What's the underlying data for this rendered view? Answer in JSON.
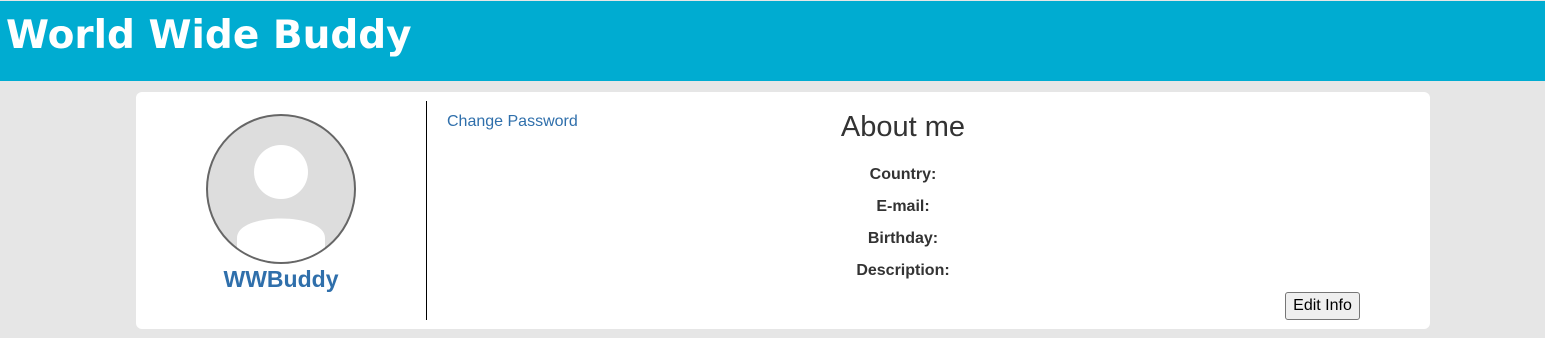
{
  "header": {
    "title": "World Wide Buddy"
  },
  "profile": {
    "username": "WWBuddy",
    "avatar_icon": "user-silhouette-icon"
  },
  "links": {
    "change_password": "Change Password"
  },
  "about": {
    "title": "About me",
    "fields": [
      {
        "label": "Country:",
        "value": ""
      },
      {
        "label": "E-mail:",
        "value": ""
      },
      {
        "label": "Birthday:",
        "value": ""
      },
      {
        "label": "Description:",
        "value": ""
      }
    ],
    "edit_button": "Edit Info"
  },
  "colors": {
    "header_bg": "#00acd1",
    "link": "#2f6fab",
    "page_bg": "#e6e6e6"
  }
}
